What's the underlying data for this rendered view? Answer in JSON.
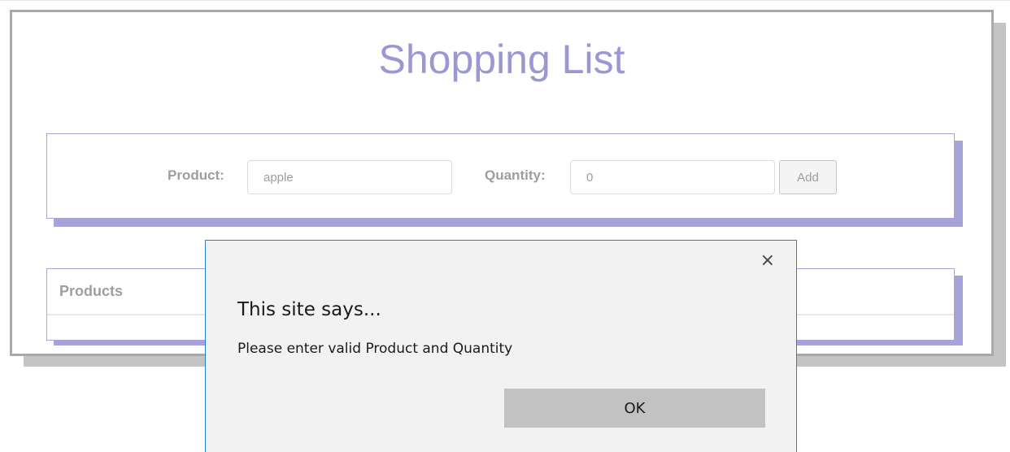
{
  "app": {
    "title": "Shopping List"
  },
  "form": {
    "product_label": "Product:",
    "product_value": "apple",
    "quantity_label": "Quantity:",
    "quantity_value": "0",
    "add_label": "Add"
  },
  "products": {
    "title": "Products"
  },
  "dialog": {
    "close_glyph": "×",
    "title": "This site says...",
    "message": "Please enter valid Product and Quantity",
    "ok_label": "OK"
  },
  "colors": {
    "accent": "#9a98d4",
    "card_border": "#a5a3d8",
    "dialog_border": "#2a7fd4",
    "ok_button": "#c2c2c2"
  }
}
